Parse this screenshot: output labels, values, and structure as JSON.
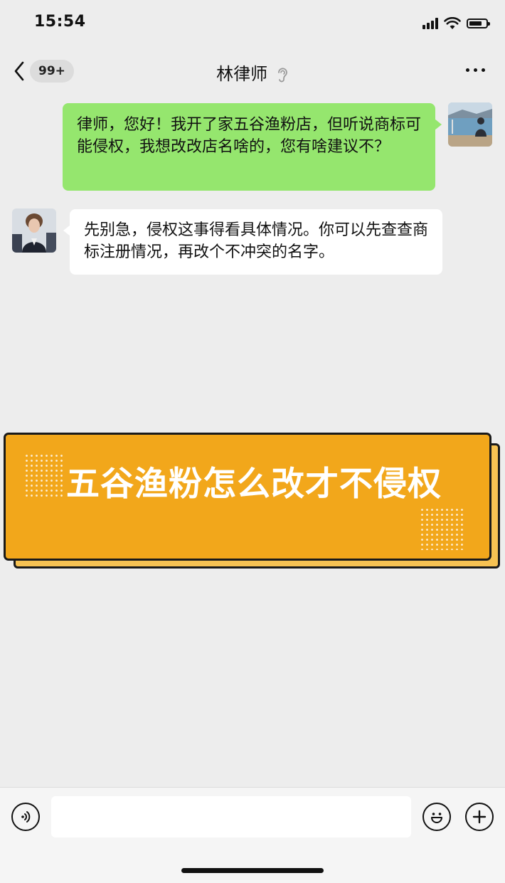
{
  "status_bar": {
    "time": "15:54",
    "battery_level": 0.78
  },
  "nav": {
    "back_badge": "99+",
    "title": "林律师",
    "icons": [
      "chevron-left-icon",
      "ear-icon",
      "more-icon"
    ]
  },
  "messages": [
    {
      "sender": "me",
      "text": "律师，您好！我开了家五谷渔粉店，但听说商标可能侵权，我想改改店名啥的，您有啥建议不？"
    },
    {
      "sender": "lawyer",
      "text": "先别急，侵权这事得看具体情况。你可以先查查商标注册情况，再改个不冲突的名字。"
    }
  ],
  "banner": {
    "text": "五谷渔粉怎么改才不侵权"
  },
  "input_bar": {
    "value": "",
    "icons": [
      "voice-icon",
      "emoji-icon",
      "plus-icon"
    ]
  },
  "colors": {
    "my_bubble": "#95e66e",
    "banner": "#f2a71b",
    "background": "#ededed"
  }
}
